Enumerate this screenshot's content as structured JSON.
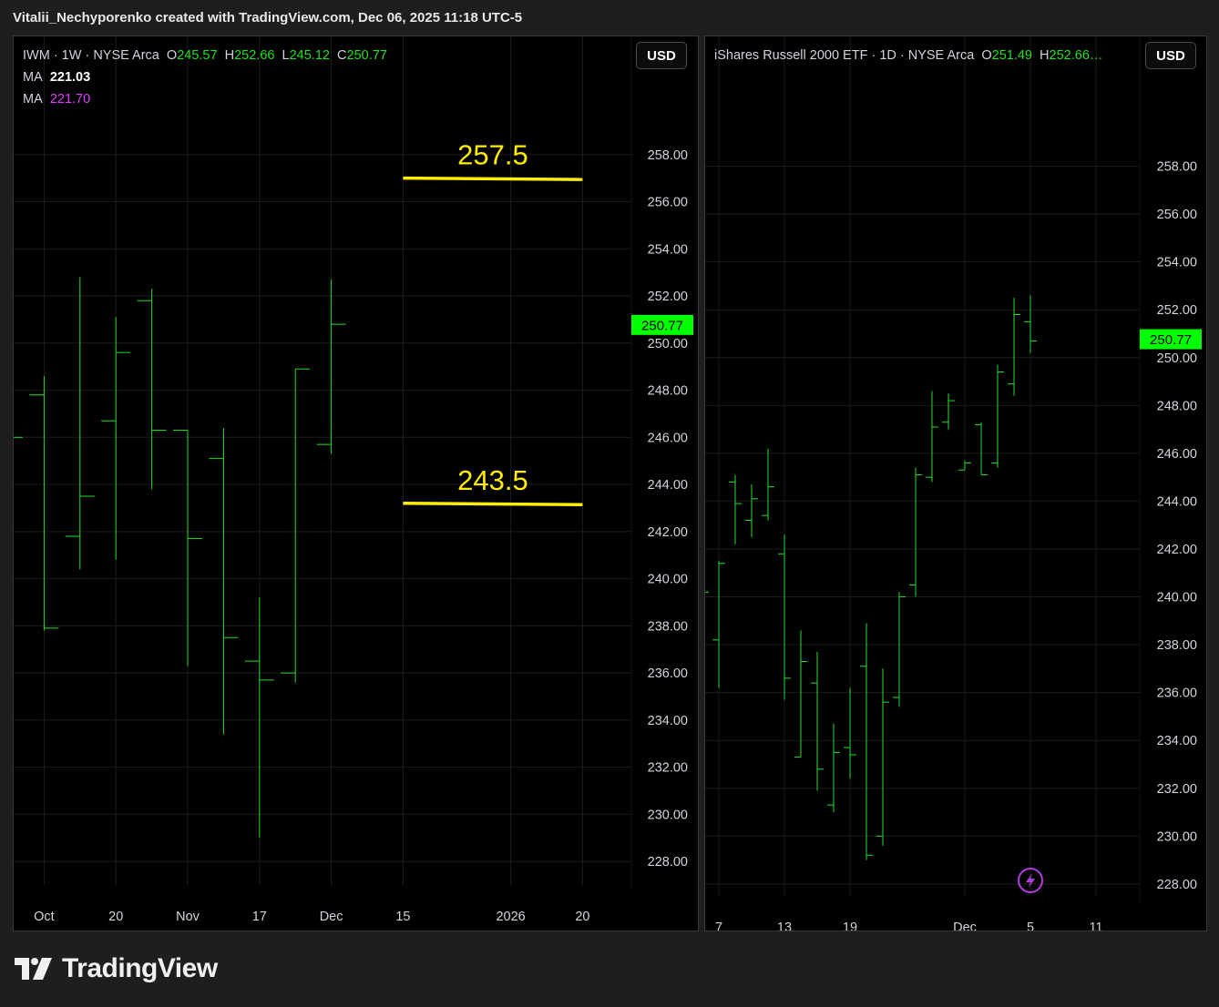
{
  "attribution": "Vitalii_Nechyporenko created with TradingView.com, Dec 06, 2025 11:18 UTC-5",
  "brand": "TradingView",
  "colors": {
    "bar": "#22e022",
    "price_badge": "#00ff00",
    "annotation": "#ffee00",
    "ma2": "#e040fb",
    "background": "#000000"
  },
  "left": {
    "legend": {
      "symbol": "IWM · 1W · NYSE Arca",
      "o_label": "O",
      "o": "245.57",
      "h_label": "H",
      "h": "252.66",
      "l_label": "L",
      "l": "245.12",
      "c_label": "C",
      "c": "250.77",
      "ma1_label": "MA",
      "ma1": "221.03",
      "ma2_label": "MA",
      "ma2": "221.70"
    },
    "currency": "USD",
    "price_badge": "250.77"
  },
  "right": {
    "legend": {
      "symbol": "iShares Russell 2000 ETF · 1D · NYSE Arca",
      "o_label": "O",
      "o": "251.49",
      "h_label": "H",
      "h": "252.66…"
    },
    "currency": "USD",
    "price_badge": "250.77",
    "flash_icon": "lightning-icon"
  },
  "chart_data": [
    {
      "type": "ohlc",
      "title": "IWM · 1W · NYSE Arca",
      "ylim": [
        227.0,
        260.0
      ],
      "y_ticks": [
        "228.00",
        "230.00",
        "232.00",
        "234.00",
        "236.00",
        "238.00",
        "240.00",
        "242.00",
        "244.00",
        "246.00",
        "248.00",
        "250.00",
        "252.00",
        "254.00",
        "256.00",
        "258.00"
      ],
      "x_ticks": [
        {
          "label": "Oct",
          "bar": 1
        },
        {
          "label": "20",
          "bar": 3
        },
        {
          "label": "Nov",
          "bar": 5
        },
        {
          "label": "17",
          "bar": 7
        },
        {
          "label": "Dec",
          "bar": 9
        },
        {
          "label": "15",
          "bar": 11
        },
        {
          "label": "2026",
          "bar": 14
        },
        {
          "label": "20",
          "bar": 16
        }
      ],
      "bar_count": 18,
      "bars": [
        {
          "o": 246.0,
          "h": 246.0,
          "l": 246.0,
          "c": 246.0
        },
        {
          "o": 247.8,
          "h": 248.6,
          "l": 237.8,
          "c": 237.9
        },
        {
          "o": 241.8,
          "h": 252.8,
          "l": 240.4,
          "c": 243.5
        },
        {
          "o": 246.7,
          "h": 251.1,
          "l": 240.8,
          "c": 249.6
        },
        {
          "o": 251.8,
          "h": 252.3,
          "l": 243.8,
          "c": 246.3
        },
        {
          "o": 246.3,
          "h": 246.3,
          "l": 236.3,
          "c": 241.7
        },
        {
          "o": 245.1,
          "h": 246.4,
          "l": 233.4,
          "c": 237.5
        },
        {
          "o": 236.5,
          "h": 239.2,
          "l": 229.0,
          "c": 235.7
        },
        {
          "o": 236.0,
          "h": 248.9,
          "l": 235.6,
          "c": 248.9
        },
        {
          "o": 245.7,
          "h": 252.7,
          "l": 245.3,
          "c": 250.8
        }
      ],
      "annotations": [
        {
          "text": "257.5",
          "price": 257.5,
          "line_price": 257.0,
          "from_bar": 11,
          "to_bar": 16
        },
        {
          "text": "243.5",
          "price": 243.5,
          "line_price": 243.2,
          "from_bar": 11,
          "to_bar": 16
        }
      ],
      "last_price": 250.77
    },
    {
      "type": "ohlc",
      "title": "iShares Russell 2000 ETF · 1D · NYSE Arca",
      "ylim": [
        227.5,
        260.0
      ],
      "y_ticks": [
        "228.00",
        "230.00",
        "232.00",
        "234.00",
        "236.00",
        "238.00",
        "240.00",
        "242.00",
        "244.00",
        "246.00",
        "248.00",
        "250.00",
        "252.00",
        "254.00",
        "256.00",
        "258.00"
      ],
      "x_ticks": [
        {
          "label": "7",
          "bar": 1
        },
        {
          "label": "13",
          "bar": 5
        },
        {
          "label": "19",
          "bar": 9
        },
        {
          "label": "Dec",
          "bar": 16
        },
        {
          "label": "5",
          "bar": 20
        },
        {
          "label": "11",
          "bar": 24
        }
      ],
      "bar_count": 27,
      "bars": [
        {
          "o": 240.2,
          "h": 240.2,
          "l": 240.2,
          "c": 240.2
        },
        {
          "o": 238.2,
          "h": 241.5,
          "l": 236.2,
          "c": 241.4
        },
        {
          "o": 244.8,
          "h": 245.1,
          "l": 242.2,
          "c": 243.9
        },
        {
          "o": 243.2,
          "h": 244.7,
          "l": 242.5,
          "c": 244.1
        },
        {
          "o": 243.4,
          "h": 246.2,
          "l": 243.2,
          "c": 244.6
        },
        {
          "o": 241.8,
          "h": 242.6,
          "l": 235.7,
          "c": 236.6
        },
        {
          "o": 233.3,
          "h": 238.6,
          "l": 233.3,
          "c": 237.3
        },
        {
          "o": 236.4,
          "h": 237.7,
          "l": 231.9,
          "c": 232.8
        },
        {
          "o": 231.3,
          "h": 234.7,
          "l": 231.0,
          "c": 233.5
        },
        {
          "o": 233.7,
          "h": 236.2,
          "l": 232.4,
          "c": 233.4
        },
        {
          "o": 237.1,
          "h": 238.9,
          "l": 229.0,
          "c": 229.2
        },
        {
          "o": 230.0,
          "h": 237.0,
          "l": 229.6,
          "c": 235.6
        },
        {
          "o": 235.8,
          "h": 240.2,
          "l": 235.4,
          "c": 240.0
        },
        {
          "o": 240.5,
          "h": 245.4,
          "l": 240.0,
          "c": 245.1
        },
        {
          "o": 245.0,
          "h": 248.6,
          "l": 244.8,
          "c": 247.1
        },
        {
          "o": 247.3,
          "h": 248.5,
          "l": 247.0,
          "c": 248.2
        },
        {
          "o": 245.3,
          "h": 245.7,
          "l": 245.3,
          "c": 245.6
        },
        {
          "o": 247.2,
          "h": 247.3,
          "l": 245.1,
          "c": 245.1
        },
        {
          "o": 245.6,
          "h": 249.7,
          "l": 245.4,
          "c": 249.4
        },
        {
          "o": 248.9,
          "h": 252.5,
          "l": 248.4,
          "c": 251.8
        },
        {
          "o": 251.5,
          "h": 252.6,
          "l": 250.2,
          "c": 250.7
        }
      ],
      "last_price": 250.77
    }
  ]
}
